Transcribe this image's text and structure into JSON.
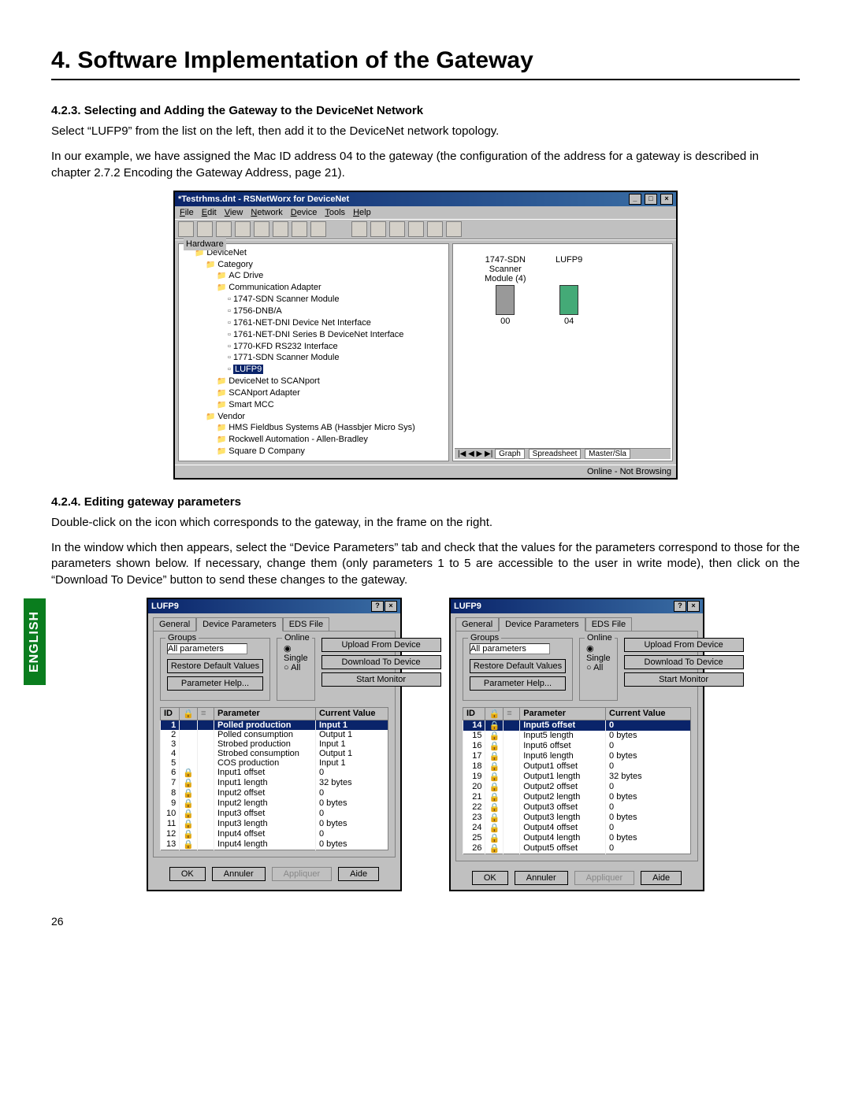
{
  "chapter_title": "4. Software Implementation of the Gateway",
  "page_number": "26",
  "sidebar_label": "ENGLISH",
  "section_423": {
    "heading": "4.2.3. Selecting and Adding the Gateway to the DeviceNet Network",
    "p1": "Select “LUFP9” from the list on the left, then add it to the DeviceNet network topology.",
    "p2": "In our example, we have assigned the Mac ID address 04 to the gateway (the configuration of the address for a gateway is described in chapter 2.7.2 Encoding the Gateway Address, page 21)."
  },
  "rsnetworx": {
    "title": "*Testrhms.dnt - RSNetWorx for DeviceNet",
    "menu": [
      "File",
      "Edit",
      "View",
      "Network",
      "Device",
      "Tools",
      "Help"
    ],
    "hardware_label": "Hardware",
    "tree": [
      {
        "lvl": 1,
        "t": "DeviceNet",
        "cls": "fld"
      },
      {
        "lvl": 2,
        "t": "Category",
        "cls": "fld"
      },
      {
        "lvl": 3,
        "t": "AC Drive",
        "cls": "fld"
      },
      {
        "lvl": 3,
        "t": "Communication Adapter",
        "cls": "fld"
      },
      {
        "lvl": 4,
        "t": "1747-SDN Scanner Module",
        "cls": "dev"
      },
      {
        "lvl": 4,
        "t": "1756-DNB/A",
        "cls": "dev"
      },
      {
        "lvl": 4,
        "t": "1761-NET-DNI Device Net Interface",
        "cls": "dev"
      },
      {
        "lvl": 4,
        "t": "1761-NET-DNI Series B DeviceNet Interface",
        "cls": "dev"
      },
      {
        "lvl": 4,
        "t": "1770-KFD RS232 Interface",
        "cls": "dev"
      },
      {
        "lvl": 4,
        "t": "1771-SDN Scanner Module",
        "cls": "dev"
      },
      {
        "lvl": 4,
        "t": "LUFP9",
        "cls": "dev",
        "sel": true
      },
      {
        "lvl": 3,
        "t": "DeviceNet to SCANport",
        "cls": "fld"
      },
      {
        "lvl": 3,
        "t": "SCANport Adapter",
        "cls": "fld"
      },
      {
        "lvl": 3,
        "t": "Smart MCC",
        "cls": "fld"
      },
      {
        "lvl": 2,
        "t": "Vendor",
        "cls": "fld"
      },
      {
        "lvl": 3,
        "t": "HMS Fieldbus Systems AB (Hassbjer Micro Sys)",
        "cls": "fld"
      },
      {
        "lvl": 3,
        "t": "Rockwell Automation - Allen-Bradley",
        "cls": "fld"
      },
      {
        "lvl": 3,
        "t": "Square D Company",
        "cls": "fld"
      }
    ],
    "dev1": {
      "name": "1747-SDN",
      "sub1": "Scanner",
      "sub2": "Module (4)",
      "addr": "00"
    },
    "dev2": {
      "name": "LUFP9",
      "addr": "04"
    },
    "tabs": [
      "Graph",
      "Spreadsheet",
      "Master/Sla"
    ],
    "status": "Online - Not Browsing"
  },
  "section_424": {
    "heading": "4.2.4. Editing gateway parameters",
    "p1": "Double-click on the icon which corresponds to the gateway, in the frame on the right.",
    "p2": "In the window which then appears, select the “Device Parameters” tab and check that the values for the parameters correspond to those for the parameters shown below. If necessary, change them (only parameters 1 to 5 are accessible to the user in write mode), then click on the “Download To Device” button to send these changes to the gateway."
  },
  "dlg_common": {
    "title": "LUFP9",
    "tabs": [
      "General",
      "Device Parameters",
      "EDS File"
    ],
    "groups_label": "Groups",
    "groups_value": "All parameters",
    "restore": "Restore Default Values",
    "paramhelp": "Parameter Help...",
    "online_label": "Online",
    "opt_single": "Single",
    "opt_all": "All",
    "btn_upload": "Upload From Device",
    "btn_download": "Download To Device",
    "btn_start": "Start Monitor",
    "col_id": "ID",
    "col_param": "Parameter",
    "col_val": "Current Value",
    "ok": "OK",
    "cancel": "Annuler",
    "apply": "Appliquer",
    "help": "Aide"
  },
  "dlg_left_rows": [
    {
      "id": "1",
      "lock": "",
      "p": "Polled production",
      "v": "Input 1",
      "sel": true
    },
    {
      "id": "2",
      "lock": "",
      "p": "Polled consumption",
      "v": "Output 1"
    },
    {
      "id": "3",
      "lock": "",
      "p": "Strobed production",
      "v": "Input 1"
    },
    {
      "id": "4",
      "lock": "",
      "p": "Strobed consumption",
      "v": "Output 1"
    },
    {
      "id": "5",
      "lock": "",
      "p": "COS production",
      "v": "Input 1"
    },
    {
      "id": "6",
      "lock": "🔒",
      "p": "Input1 offset",
      "v": "0"
    },
    {
      "id": "7",
      "lock": "🔒",
      "p": "Input1 length",
      "v": "32 bytes"
    },
    {
      "id": "8",
      "lock": "🔒",
      "p": "Input2 offset",
      "v": "0"
    },
    {
      "id": "9",
      "lock": "🔒",
      "p": "Input2 length",
      "v": "0 bytes"
    },
    {
      "id": "10",
      "lock": "🔒",
      "p": "Input3 offset",
      "v": "0"
    },
    {
      "id": "11",
      "lock": "🔒",
      "p": "Input3 length",
      "v": "0 bytes"
    },
    {
      "id": "12",
      "lock": "🔒",
      "p": "Input4 offset",
      "v": "0"
    },
    {
      "id": "13",
      "lock": "🔒",
      "p": "Input4 length",
      "v": "0 bytes"
    }
  ],
  "dlg_right_rows": [
    {
      "id": "14",
      "lock": "🔒",
      "p": "Input5 offset",
      "v": "0",
      "sel": true
    },
    {
      "id": "15",
      "lock": "🔒",
      "p": "Input5 length",
      "v": "0 bytes"
    },
    {
      "id": "16",
      "lock": "🔒",
      "p": "Input6 offset",
      "v": "0"
    },
    {
      "id": "17",
      "lock": "🔒",
      "p": "Input6 length",
      "v": "0 bytes"
    },
    {
      "id": "18",
      "lock": "🔒",
      "p": "Output1 offset",
      "v": "0"
    },
    {
      "id": "19",
      "lock": "🔒",
      "p": "Output1 length",
      "v": "32 bytes"
    },
    {
      "id": "20",
      "lock": "🔒",
      "p": "Output2 offset",
      "v": "0"
    },
    {
      "id": "21",
      "lock": "🔒",
      "p": "Output2 length",
      "v": "0 bytes"
    },
    {
      "id": "22",
      "lock": "🔒",
      "p": "Output3 offset",
      "v": "0"
    },
    {
      "id": "23",
      "lock": "🔒",
      "p": "Output3 length",
      "v": "0 bytes"
    },
    {
      "id": "24",
      "lock": "🔒",
      "p": "Output4 offset",
      "v": "0"
    },
    {
      "id": "25",
      "lock": "🔒",
      "p": "Output4 length",
      "v": "0 bytes"
    },
    {
      "id": "26",
      "lock": "🔒",
      "p": "Output5 offset",
      "v": "0"
    }
  ]
}
